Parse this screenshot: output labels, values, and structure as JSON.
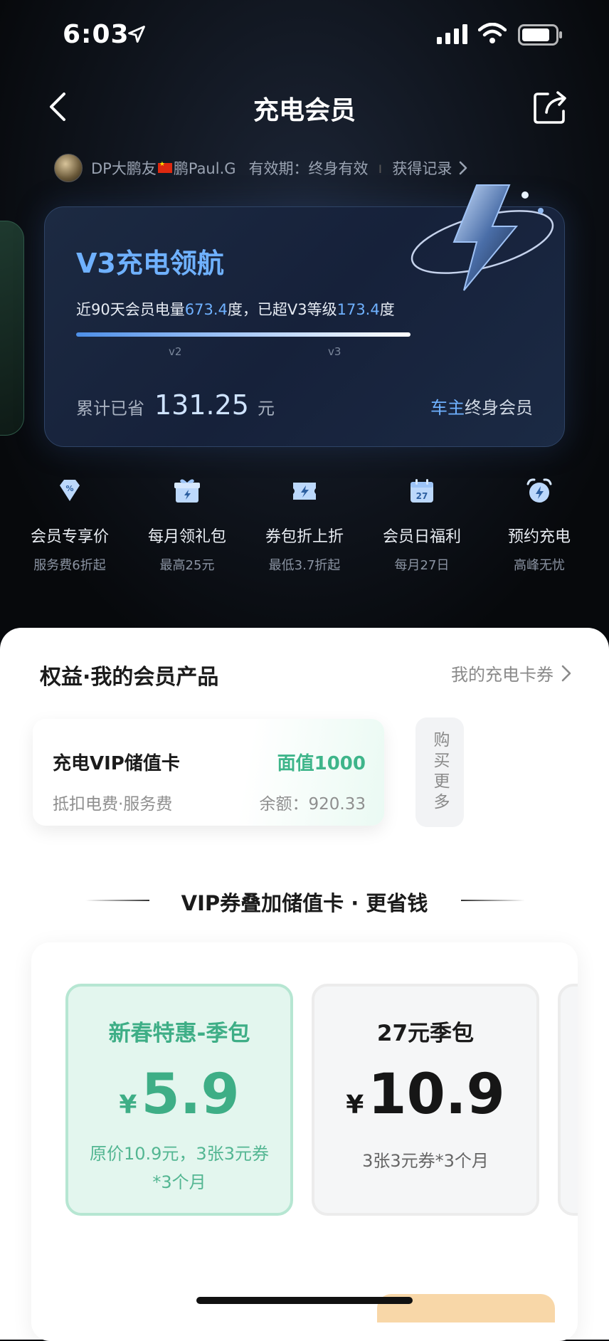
{
  "status_bar": {
    "time": "6:03"
  },
  "nav": {
    "title": "充电会员"
  },
  "user": {
    "name_prefix": "DP大鹏友",
    "name_suffix": "鹏Paul.G",
    "validity": "有效期：终身有效",
    "records_link": "获得记录"
  },
  "level_card": {
    "title": "V3充电领航",
    "desc_prefix": "近90天会员电量",
    "desc_value1": "673.4",
    "desc_mid": "度，已超V3等级",
    "desc_value2": "173.4",
    "desc_suffix": "度",
    "progress_fraction": 1.0,
    "tick_v2": "v2",
    "tick_v3": "v3",
    "saved_label": "累计已省",
    "saved_amount": "131.25",
    "saved_unit": "元",
    "member_prefix": "车主",
    "member_suffix": "终身会员"
  },
  "benefits": [
    {
      "icon": "discount-diamond-icon",
      "title": "会员专享价",
      "sub": "服务费6折起"
    },
    {
      "icon": "gift-icon",
      "title": "每月领礼包",
      "sub": "最高25元"
    },
    {
      "icon": "coupon-icon",
      "title": "券包折上折",
      "sub": "最低3.7折起"
    },
    {
      "icon": "calendar-27-icon",
      "title": "会员日福利",
      "sub": "每月27日"
    },
    {
      "icon": "alarm-clock-icon",
      "title": "预约充电",
      "sub": "高峰无忧"
    }
  ],
  "products": {
    "section_title": "权益·我的会员产品",
    "my_cards_link": "我的充电卡券",
    "vip_card": {
      "name": "充电VIP储值卡",
      "face_value": "面值1000",
      "sub": "抵扣电费·服务费",
      "balance": "余额：920.33"
    },
    "buy_more": "购买更多"
  },
  "promo": {
    "title": "VIP券叠加储值卡 · 更省钱",
    "packages": [
      {
        "name": "新春特惠-季包",
        "currency": "¥",
        "price": "5.9",
        "desc": "原价10.9元，3张3元券*3个月"
      },
      {
        "name": "27元季包",
        "currency": "¥",
        "price": "10.9",
        "desc": "3张3元券*3个月"
      }
    ]
  },
  "colors": {
    "accent_blue": "#6fb1ff",
    "accent_green": "#3eae86",
    "hero_bg": "#0a0c10"
  }
}
